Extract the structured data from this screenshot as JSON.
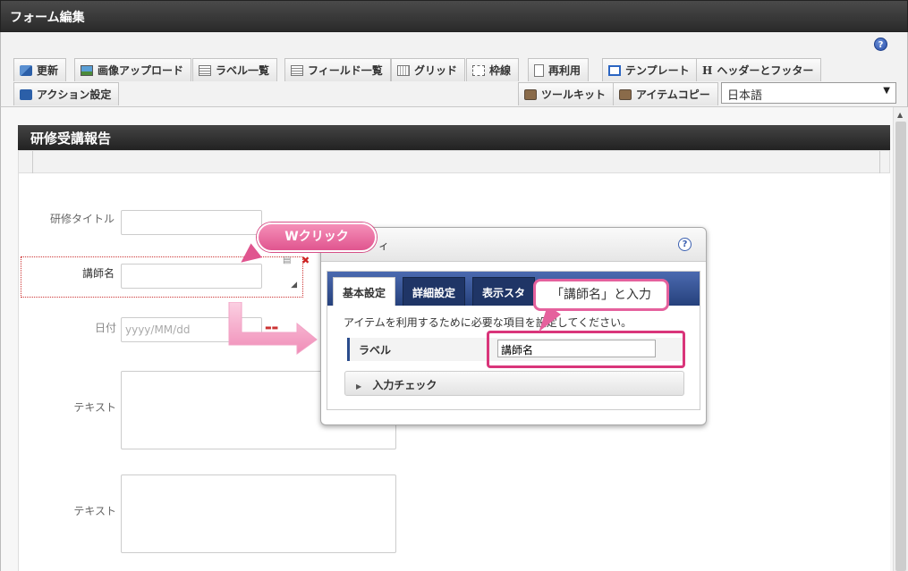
{
  "window": {
    "title": "フォーム編集"
  },
  "toolbar": {
    "row1": [
      {
        "label": "更新",
        "icon": "refresh-icon"
      },
      {
        "label": "画像アップロード",
        "icon": "image-upload-icon"
      },
      {
        "label": "ラベル一覧",
        "icon": "list-icon"
      },
      {
        "label": "フィールド一覧",
        "icon": "list-icon"
      },
      {
        "label": "グリッド",
        "icon": "grid-icon"
      },
      {
        "label": "枠線",
        "icon": "frame-icon"
      },
      {
        "label": "再利用",
        "icon": "document-icon"
      },
      {
        "label": "テンプレート",
        "icon": "template-icon"
      },
      {
        "label": "ヘッダーとフッター",
        "icon": "header-icon",
        "glyph": "H"
      }
    ],
    "row2_left": {
      "label": "アクション設定",
      "icon": "action-icon"
    },
    "row2_right": [
      {
        "label": "ツールキット",
        "icon": "toolbox-icon"
      },
      {
        "label": "アイテムコピー",
        "icon": "toolbox-icon"
      }
    ],
    "language": {
      "value": "日本語"
    },
    "help": "?"
  },
  "form": {
    "title": "研修受講報告",
    "fields": [
      {
        "label": "研修タイトル",
        "type": "text"
      },
      {
        "label": "講師名",
        "type": "text"
      },
      {
        "label": "日付",
        "type": "date",
        "placeholder": "yyyy/MM/dd"
      },
      {
        "label": "テキスト",
        "type": "textarea"
      },
      {
        "label": "テキスト",
        "type": "textarea"
      }
    ]
  },
  "annotations": {
    "double_click": "Wクリック",
    "enter_hint": "「講師名」と入力"
  },
  "dialog": {
    "title_partial": "ィ",
    "help": "?",
    "tabs": [
      "基本設定",
      "詳細設定",
      "表示スタ"
    ],
    "active_tab": 0,
    "description": "アイテムを利用するために必要な項目を設定してください。",
    "label_row": {
      "label": "ラベル",
      "value": "講師名"
    },
    "expander": "入力チェック"
  },
  "colors": {
    "accent_pink": "#e0558f",
    "tab_blue": "#26417c",
    "header_dark": "#2a2a2a"
  }
}
